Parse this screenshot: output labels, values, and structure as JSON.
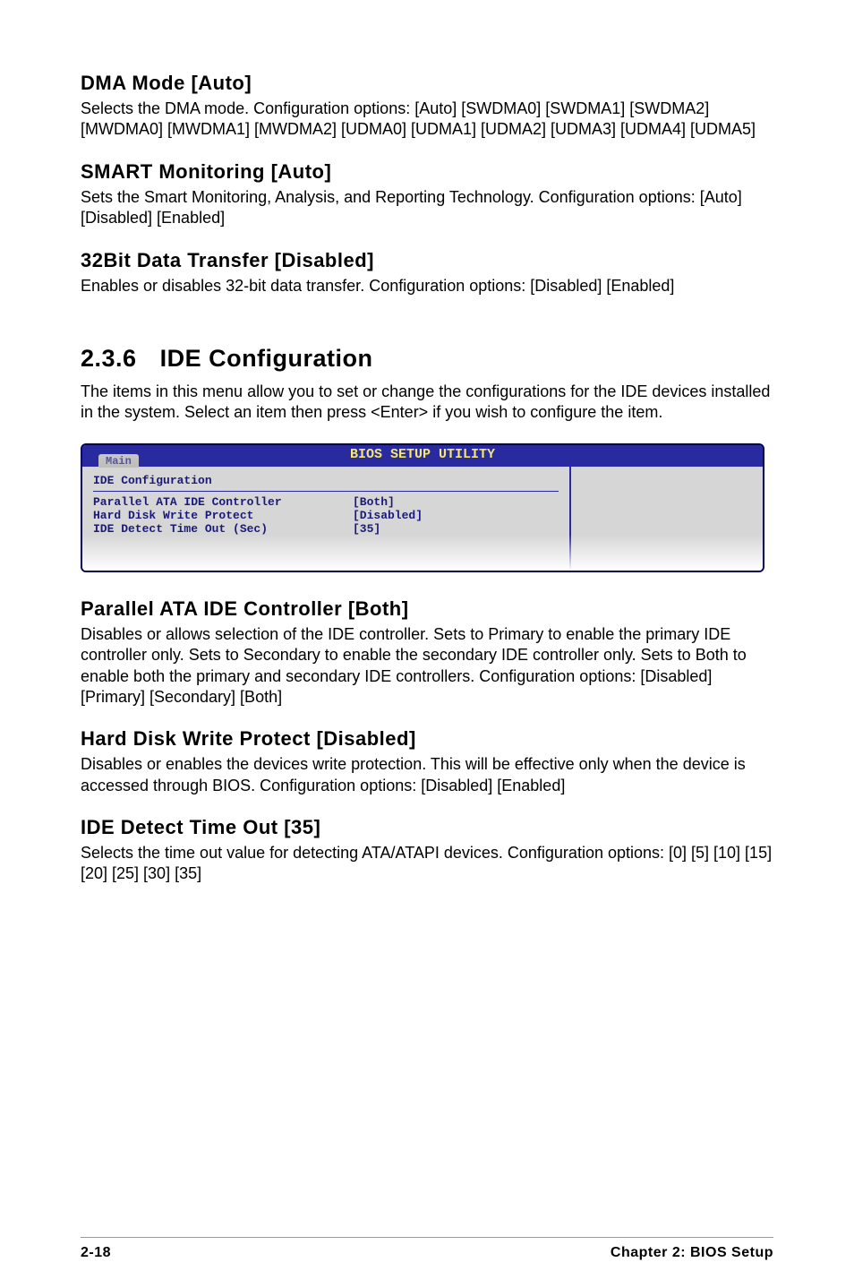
{
  "sections": {
    "dma": {
      "heading": "DMA Mode [Auto]",
      "body": "Selects the DMA mode. Configuration options: [Auto] [SWDMA0] [SWDMA1] [SWDMA2] [MWDMA0] [MWDMA1] [MWDMA2] [UDMA0] [UDMA1] [UDMA2] [UDMA3] [UDMA4] [UDMA5]"
    },
    "smart": {
      "heading": "SMART Monitoring [Auto]",
      "body": "Sets the Smart Monitoring, Analysis, and Reporting Technology. Configuration options: [Auto] [Disabled] [Enabled]"
    },
    "x32": {
      "heading": "32Bit Data Transfer [Disabled]",
      "body": "Enables or disables 32-bit data transfer. Configuration options: [Disabled] [Enabled]"
    },
    "ide": {
      "number": "2.3.6",
      "heading": "IDE Configuration",
      "body": "The items in this menu allow you to set or change the configurations for the IDE devices installed in the system. Select an item then press <Enter> if you wish to configure the item."
    },
    "pata": {
      "heading": "Parallel ATA IDE Controller [Both]",
      "body": "Disables or allows selection of the IDE controller. Sets to Primary to enable the primary IDE controller only. Sets to Secondary to enable the secondary IDE controller only. Sets to Both to enable both the primary and secondary IDE controllers. Configuration options: [Disabled] [Primary] [Secondary] [Both]"
    },
    "hdwp": {
      "heading": "Hard Disk Write Protect [Disabled]",
      "body": "Disables or enables the devices write protection. This will be effective only when the device is accessed through BIOS. Configuration options: [Disabled] [Enabled]"
    },
    "timeout": {
      "heading": "IDE Detect Time Out [35]",
      "body": "Selects the time out value for detecting ATA/ATAPI devices. Configuration options: [0] [5] [10] [15] [20] [25] [30] [35]"
    }
  },
  "bios": {
    "title": "BIOS SETUP UTILITY",
    "tab": "Main",
    "section": "IDE Configuration",
    "rows": [
      {
        "k": "Parallel ATA IDE Controller",
        "v": "[Both]"
      },
      {
        "k": "Hard Disk Write Protect",
        "v": "[Disabled]"
      },
      {
        "k": "IDE Detect Time Out (Sec)",
        "v": "[35]"
      }
    ]
  },
  "footer": {
    "left": "2-18",
    "right": "Chapter 2: BIOS Setup"
  }
}
